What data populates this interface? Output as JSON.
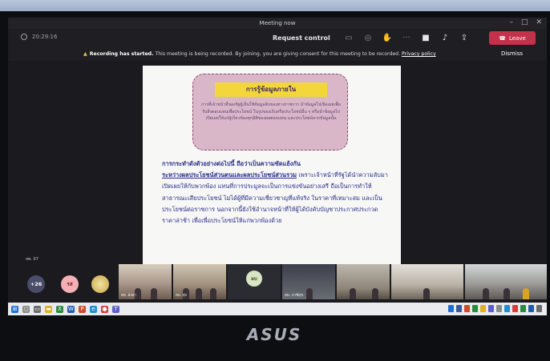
{
  "window": {
    "title": "Meeting now"
  },
  "toolbar": {
    "timer": "20:29:16",
    "request_control": "Request control",
    "leave": "Leave"
  },
  "banner": {
    "bold": "Recording has started.",
    "message": "This meeting is being recorded. By joining, you are giving consent for this meeting to be recorded.",
    "link": "Privacy policy",
    "dismiss": "Dismiss"
  },
  "slide": {
    "callout_title": "การรู้ข้อมูลภายใน",
    "callout_body": "การที่เจ้าหน้าที่ของรัฐผู้เห็นใช้ข้อมูลลับของทางราชการ นำข้อมูลไปเปิดเผยเพื่อรับสิ่งตอบแทนเพื่อประโยชน์ ในรูปของเงินหรือประโยชน์อื่น ๆ หรือนำข้อมูลไปเปิดเผยให้แก่ผู้เกี่ยวข้องทุกมิติของผลตอบแทน และประโยชน์จากข้อมูลนั้น",
    "lead": "การกระทำดังตัวอย่างต่อไปนี้ ถือว่าเป็นความขัดแย้งกัน",
    "highlight": "ระหว่างผลประโยชน์ส่วนตนและผลประโยชน์ส่วนรวม",
    "body": "เพราะเจ้าหน้าที่รัฐได้นำความลับมาเปิดเผยให้กับพวกพ้อง แทนที่การประมูลจะเป็นการแข่งขันอย่างเสรี ถือเป็นการทำให้สาธารณะเสียประโยชน์ ไม่ได้ผู้ที่มีความเชี่ยวชาญที่แท้จริง ในราคาที่เหมาะสม และเป็นประโยชน์ต่อราชการ นอกจากนี้ยังใช้อำนาจหน้าที่ให้ผู้ได้บังคับบัญชาประกาศประกวดราคาล่าช้า เพื่อเพื่อประโยชน์ให้แก่พวกพ้องด้วย"
  },
  "participants": {
    "left_label": "สพ. 07",
    "more_count": "+26",
    "initials_1": "รส",
    "tile_names": [
      "สพ. ล้งลา",
      "สพ. ทุ่ง",
      "",
      "สพ. ภาชีสุข",
      "",
      "",
      ""
    ],
    "tile3_initials": "ผบ"
  },
  "device": {
    "brand": "ASUS"
  },
  "colors": {
    "leave": "#c4314b",
    "callout": "#d9b6c8",
    "callout_title": "#f3d63c",
    "slide_text": "#2b2f8c"
  }
}
